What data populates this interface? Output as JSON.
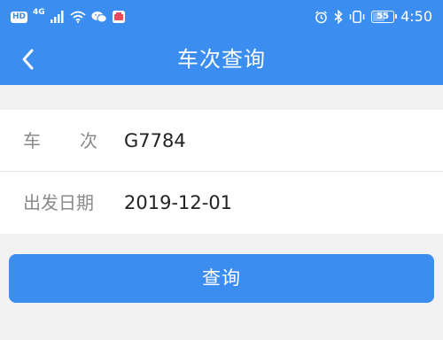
{
  "status_bar": {
    "hd_badge": "HD",
    "network": "4G",
    "battery": "55",
    "time": "4:50",
    "icons": [
      "hd-icon",
      "signal-icon",
      "wifi-icon",
      "wechat-icon",
      "app-notification-icon",
      "alarm-icon",
      "bluetooth-icon",
      "vibrate-icon",
      "battery-icon"
    ]
  },
  "header": {
    "back_icon": "chevron-left-icon",
    "title": "车次查询"
  },
  "form": {
    "train": {
      "label_chars": [
        "车",
        "次"
      ],
      "value": "G7784"
    },
    "date": {
      "label": "出发日期",
      "value": "2019-12-01"
    }
  },
  "actions": {
    "query_label": "查询"
  },
  "colors": {
    "accent": "#3b8ef0",
    "background": "#f2f2f2",
    "card": "#ffffff",
    "label_text": "#8a8a8a",
    "value_text": "#222222"
  }
}
